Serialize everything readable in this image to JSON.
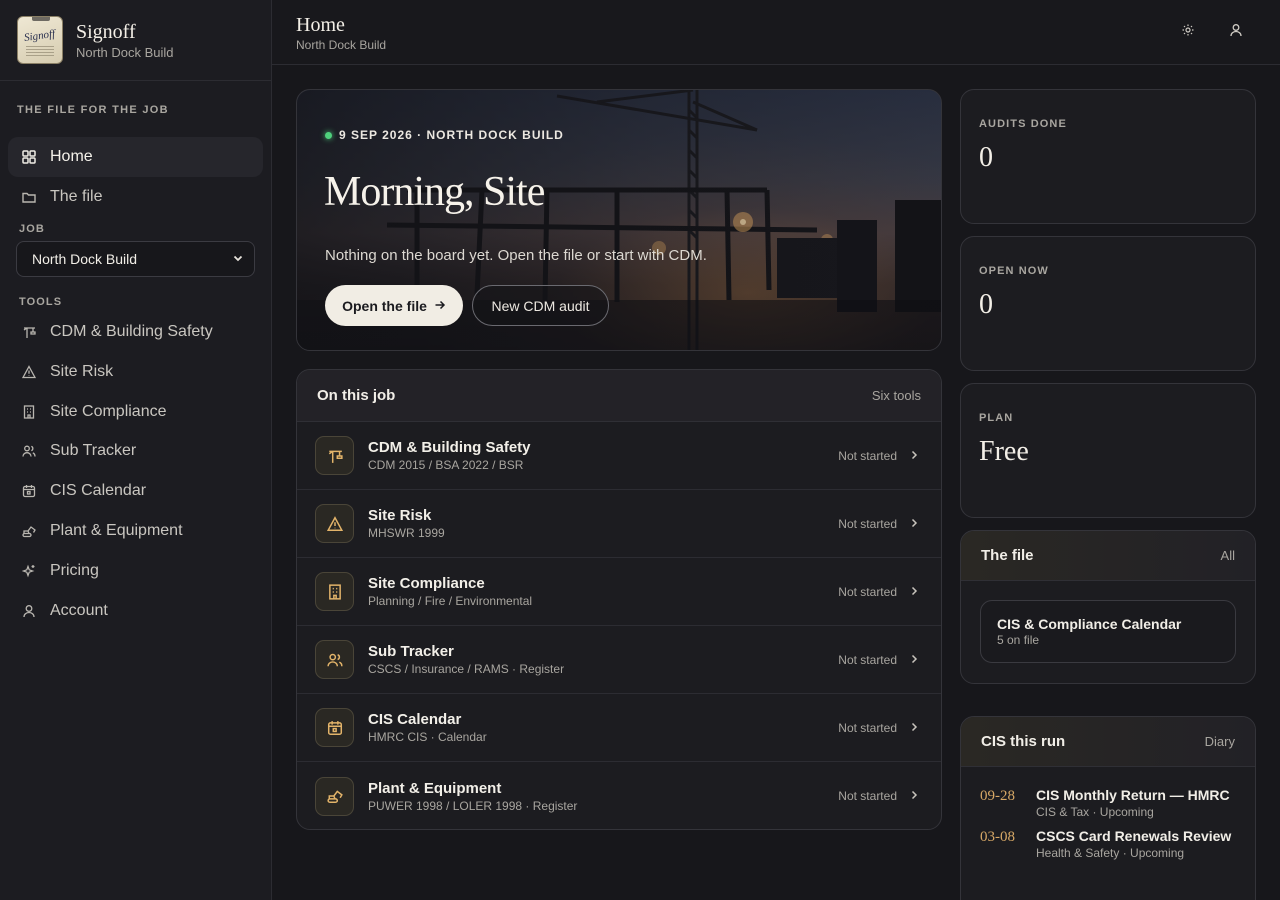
{
  "brand": {
    "title": "Signoff",
    "subtitle": "North Dock Build",
    "logo_text": "Signoff"
  },
  "sidebar": {
    "caption": "THE FILE FOR THE JOB",
    "nav": [
      {
        "label": "Home",
        "icon": "grid-icon",
        "active": true
      },
      {
        "label": "The file",
        "icon": "folder-icon"
      }
    ],
    "job_label": "JOB",
    "job_value": "North Dock Build",
    "tools_label": "TOOLS",
    "tools": [
      {
        "label": "CDM & Building Safety",
        "icon": "crane-icon"
      },
      {
        "label": "Site Risk",
        "icon": "warning-icon"
      },
      {
        "label": "Site Compliance",
        "icon": "building-icon"
      },
      {
        "label": "Sub Tracker",
        "icon": "users-icon"
      },
      {
        "label": "CIS Calendar",
        "icon": "calendar-icon"
      },
      {
        "label": "Plant & Equipment",
        "icon": "excavator-icon"
      },
      {
        "label": "Pricing",
        "icon": "sparkles-icon"
      },
      {
        "label": "Account",
        "icon": "user-icon"
      }
    ]
  },
  "topbar": {
    "title": "Home",
    "subtitle": "North Dock Build",
    "theme_icon": "sun-icon",
    "account_icon": "user-icon"
  },
  "hero": {
    "kicker": "9 SEP 2026 · NORTH DOCK BUILD",
    "title": "Morning, Site",
    "text": "Nothing on the board yet. Open the file or start with CDM.",
    "primary_label": "Open the file",
    "primary_icon": "arrow-right-icon",
    "secondary_label": "New CDM audit"
  },
  "tools_card": {
    "title": "On this job",
    "aside": "Six tools",
    "rows": [
      {
        "name": "CDM & Building Safety",
        "desc": "CDM 2015 / BSA 2022 / BSR",
        "status": "Not started",
        "icon": "crane-icon"
      },
      {
        "name": "Site Risk",
        "desc": "MHSWR 1999",
        "status": "Not started",
        "icon": "warning-icon"
      },
      {
        "name": "Site Compliance",
        "desc": "Planning / Fire / Environmental",
        "status": "Not started",
        "icon": "building-icon"
      },
      {
        "name": "Sub Tracker",
        "desc": "CSCS / Insurance / RAMS · Register",
        "status": "Not started",
        "icon": "users-icon"
      },
      {
        "name": "CIS Calendar",
        "desc": "HMRC CIS · Calendar",
        "status": "Not started",
        "icon": "calendar-icon"
      },
      {
        "name": "Plant & Equipment",
        "desc": "PUWER 1998 / LOLER 1998 · Register",
        "status": "Not started",
        "icon": "excavator-icon"
      }
    ]
  },
  "stats": [
    {
      "label": "AUDITS DONE",
      "value": "0"
    },
    {
      "label": "OPEN NOW",
      "value": "0"
    },
    {
      "label": "PLAN",
      "value": "Free"
    }
  ],
  "file_panel": {
    "title": "The file",
    "aside": "All",
    "card": {
      "name": "CIS & Compliance Calendar",
      "count": "5 on file"
    }
  },
  "cis_panel": {
    "title": "CIS this run",
    "aside": "Diary",
    "items": [
      {
        "date": "09-28",
        "title": "CIS Monthly Return — HMRC",
        "meta": "CIS & Tax · Upcoming"
      },
      {
        "date": "03-08",
        "title": "CSCS Card Renewals Review",
        "meta": "Health & Safety · Upcoming"
      }
    ]
  },
  "colors": {
    "accent": "#e3b46a",
    "live": "#4fd17c",
    "background": "#17171b",
    "panel": "#1c1c20"
  }
}
